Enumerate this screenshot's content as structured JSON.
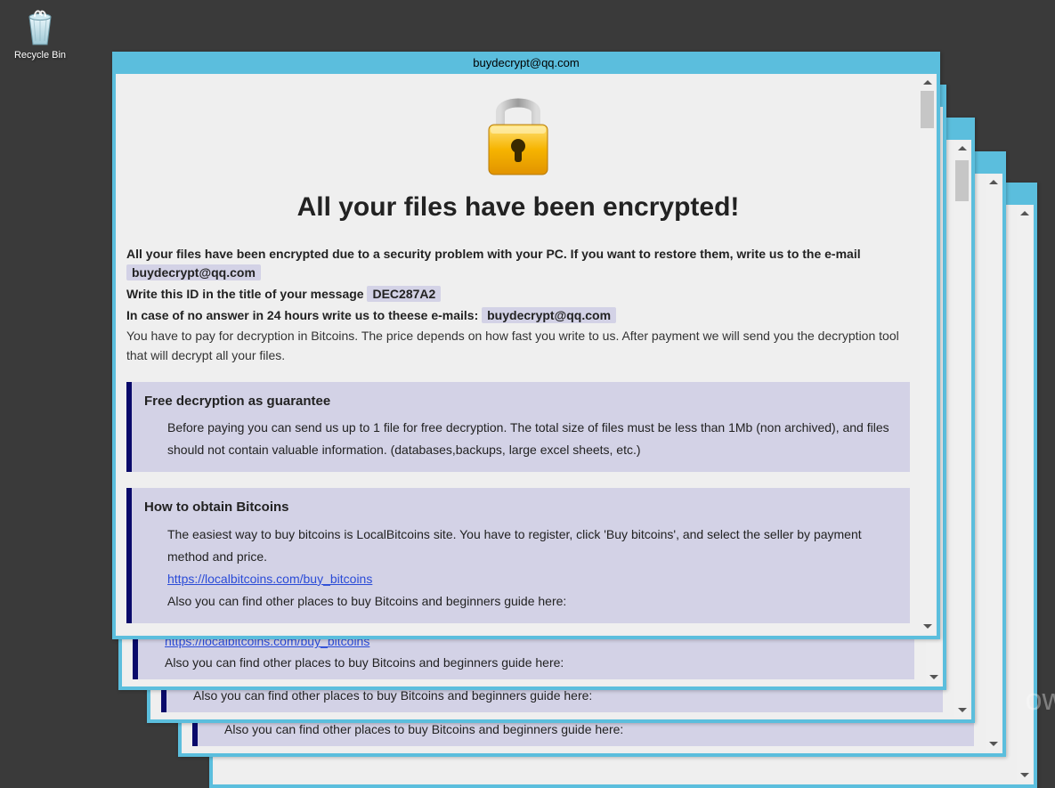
{
  "desktop": {
    "recycle_bin_label": "Recycle Bin"
  },
  "window": {
    "title": "buydecrypt@qq.com"
  },
  "headline": "All your files have been encrypted!",
  "body": {
    "intro_a": "All your files have been encrypted due to a security problem with your PC. If you want to restore them, write us to the e-mail ",
    "email1": "buydecrypt@qq.com",
    "id_line_a": "Write this ID in the title of your message ",
    "id_value": "DEC287A2",
    "noanswer_a": "In case of no answer in 24 hours write us to theese e-mails: ",
    "email2": "buydecrypt@qq.com",
    "payline": "You have to pay for decryption in Bitcoins. The price depends on how fast you write to us. After payment we will send you the decryption tool that will decrypt all your files."
  },
  "guarantee": {
    "title": "Free decryption as guarantee",
    "text": "Before paying you can send us up to 1 file for free decryption. The total size of files must be less than 1Mb (non archived), and files should not contain valuable information. (databases,backups, large excel sheets, etc.)"
  },
  "howto": {
    "title": "How to obtain Bitcoins",
    "text1": "The easiest way to buy bitcoins is LocalBitcoins site. You have to register, click 'Buy bitcoins', and select the seller by payment method and price.",
    "link1": "https://localbitcoins.com/buy_bitcoins",
    "text2": "Also you can find other places to buy Bitcoins and beginners guide here:"
  },
  "frag": {
    "priceline": "payment method and price.",
    "link": "https://localbitcoins.com/buy_bitcoins",
    "also": "Also you can find other places to buy Bitcoins and beginners guide here:"
  },
  "watermark": "ow"
}
